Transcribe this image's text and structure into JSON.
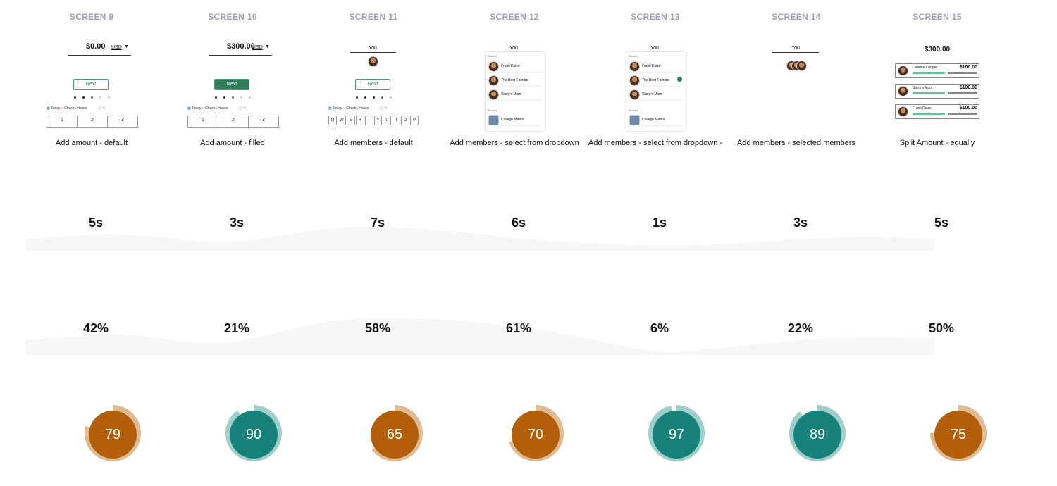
{
  "colors": {
    "screen_label": "#9aa0b4",
    "orange_core": "#b35e0a",
    "orange_ring": "#dfbb90",
    "teal_core": "#17827a",
    "teal_ring": "#9ecfca",
    "accent_green": "#2f7d5b"
  },
  "screens": [
    {
      "label": "SCREEN 9",
      "caption": "Add amount - default",
      "time": "5s",
      "pct": "42%",
      "score": "79",
      "score_value": 79,
      "theme": "orange",
      "thumb": {
        "kind": "amount",
        "amount": "$0.00",
        "currency": "USD",
        "next": "Next",
        "toolbar": {
          "date": "Today",
          "group": "Chucks House"
        },
        "keys": [
          "1",
          "2",
          "3"
        ]
      }
    },
    {
      "label": "SCREEN 10",
      "caption": "Add amount - filled",
      "time": "3s",
      "pct": "21%",
      "score": "90",
      "score_value": 90,
      "theme": "teal",
      "thumb": {
        "kind": "amount",
        "amount": "$300.00",
        "currency": "USD",
        "next": "Next",
        "toolbar": {
          "date": "Today",
          "group": "Chucks House"
        },
        "keys": [
          "1",
          "2",
          "3"
        ]
      }
    },
    {
      "label": "SCREEN 11",
      "caption": "Add members - default",
      "time": "7s",
      "pct": "58%",
      "score": "65",
      "score_value": 65,
      "theme": "orange",
      "thumb": {
        "kind": "members",
        "you": "You",
        "next": "Next",
        "toolbar": {
          "date": "Today",
          "group": "Chucks House"
        },
        "keys": [
          "Q",
          "W",
          "E",
          "R",
          "T",
          "Y",
          "U",
          "I",
          "O",
          "P"
        ]
      }
    },
    {
      "label": "SCREEN 12",
      "caption": "Add members - select from dropdown",
      "time": "6s",
      "pct": "61%",
      "score": "70",
      "score_value": 70,
      "theme": "orange",
      "thumb": {
        "kind": "dropdown",
        "you": "You",
        "recent": "Recent",
        "groups": "Groups",
        "rows": [
          "Frank Rizzo",
          "The Best Friends",
          "Stacy's Mom"
        ],
        "group_row": "College Mates"
      }
    },
    {
      "label": "SCREEN 13",
      "caption": "Add members - select from dropdown -",
      "time": "1s",
      "pct": "6%",
      "score": "97",
      "score_value": 97,
      "theme": "teal",
      "thumb": {
        "kind": "dropdown",
        "you": "You",
        "recent": "Recent",
        "groups": "Groups",
        "rows": [
          "Frank Rizzo",
          "The Best Friends",
          "Stacy's Mom"
        ],
        "group_row": "College Mates"
      }
    },
    {
      "label": "SCREEN 14",
      "caption": "Add members - selected members",
      "time": "3s",
      "pct": "22%",
      "score": "89",
      "score_value": 89,
      "theme": "teal",
      "thumb": {
        "kind": "selected",
        "you": "You"
      }
    },
    {
      "label": "SCREEN 15",
      "caption": "Split Amount - equally",
      "time": "5s",
      "pct": "50%",
      "score": "75",
      "score_value": 75,
      "theme": "orange",
      "thumb": {
        "kind": "split",
        "total": "$300.00",
        "rows": [
          {
            "name": "Charles Cooper",
            "amount": "$100.00"
          },
          {
            "name": "Stacy's Mom",
            "amount": "$100.00"
          },
          {
            "name": "Frank Rizzo",
            "amount": "$100.00"
          }
        ]
      }
    }
  ]
}
